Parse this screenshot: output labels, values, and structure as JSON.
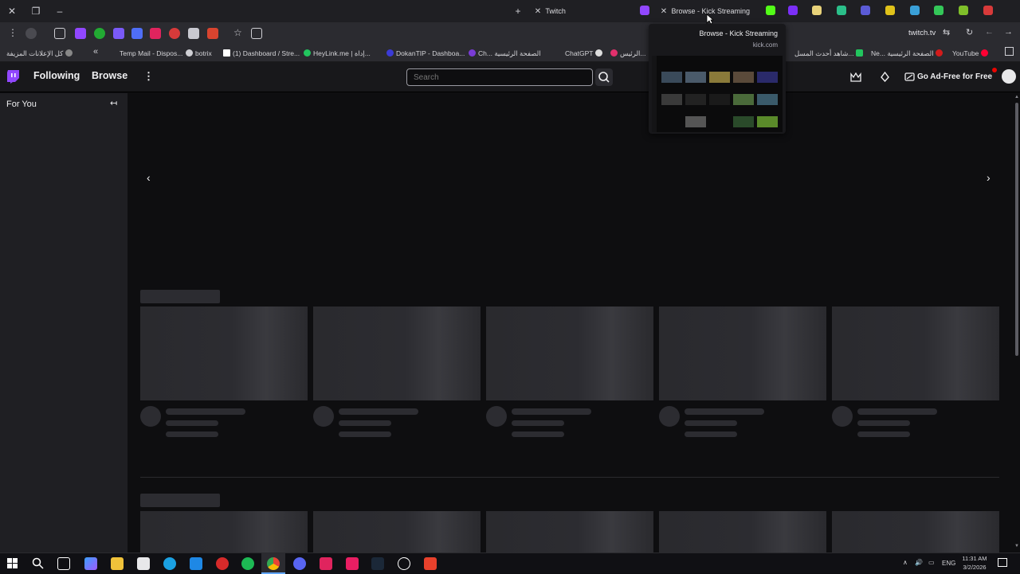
{
  "browser": {
    "tabs": [
      {
        "title": "Twitch",
        "active": true
      },
      {
        "title": "Browse - Kick Streaming",
        "active": false
      }
    ],
    "tooltip": {
      "title": "Browse - Kick Streaming",
      "domain": "kick.com"
    },
    "address": "twitch.tv",
    "bookmarks": [
      "كل الإعلانات المزيفة",
      "Temp Mail - Dispos...",
      "botrix",
      "(1) Dashboard / Stre...",
      "HeyLink.me | إداة...",
      "DokanTIP - Dashboa...",
      "Ch... الصفحة الرئيسية",
      "ChatGPT",
      "الرئيس...",
      "شاهد أحدث المسل...",
      "Ne... الصفحة الرئيسية",
      "YouTube"
    ]
  },
  "twitch": {
    "nav": {
      "following": "Following",
      "browse": "Browse",
      "search_placeholder": "Search",
      "ad_free": "Go Ad-Free for Free"
    },
    "sidebar": {
      "title": "For You"
    }
  },
  "taskbar": {
    "language": "ENG",
    "time": "11:31 AM",
    "date": "3/2/2026"
  },
  "colors": {
    "twitch_purple": "#9147ff",
    "page_bg": "#0e0e10",
    "skeleton": "#2c2c31"
  }
}
